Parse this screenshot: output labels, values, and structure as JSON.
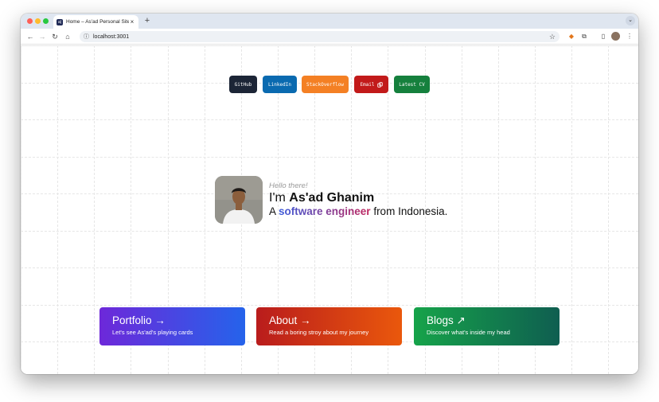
{
  "browser": {
    "tab_title": "Home – As'ad Personal Site",
    "tab_favicon_text": "a|",
    "url": "localhost:3001",
    "new_tab_symbol": "+",
    "close_symbol": "×"
  },
  "social": {
    "github": "GitHub",
    "linkedin": "LinkedIn",
    "stackoverflow": "StackOverflow",
    "email": "Email",
    "cv": "Latest CV"
  },
  "hero": {
    "hello": "Hello there!",
    "intro_prefix": "I'm ",
    "name": "As'ad Ghanim",
    "tag_prefix": "A ",
    "role": "software engineer",
    "tag_suffix": " from Indonesia."
  },
  "cards": {
    "portfolio": {
      "title": "Portfolio",
      "arrow": "→",
      "subtitle": "Let's see As'ad's playing cards"
    },
    "about": {
      "title": "About",
      "arrow": "→",
      "subtitle": "Read a boring stroy about my journey"
    },
    "blogs": {
      "title": "Blogs",
      "arrow": "↗",
      "subtitle": "Discover what's inside my head"
    }
  },
  "colors": {
    "github": "#1c2536",
    "linkedin": "#0a6ab0",
    "stackoverflow": "#f48024",
    "email": "#c21a1a",
    "cv": "#15803d"
  }
}
